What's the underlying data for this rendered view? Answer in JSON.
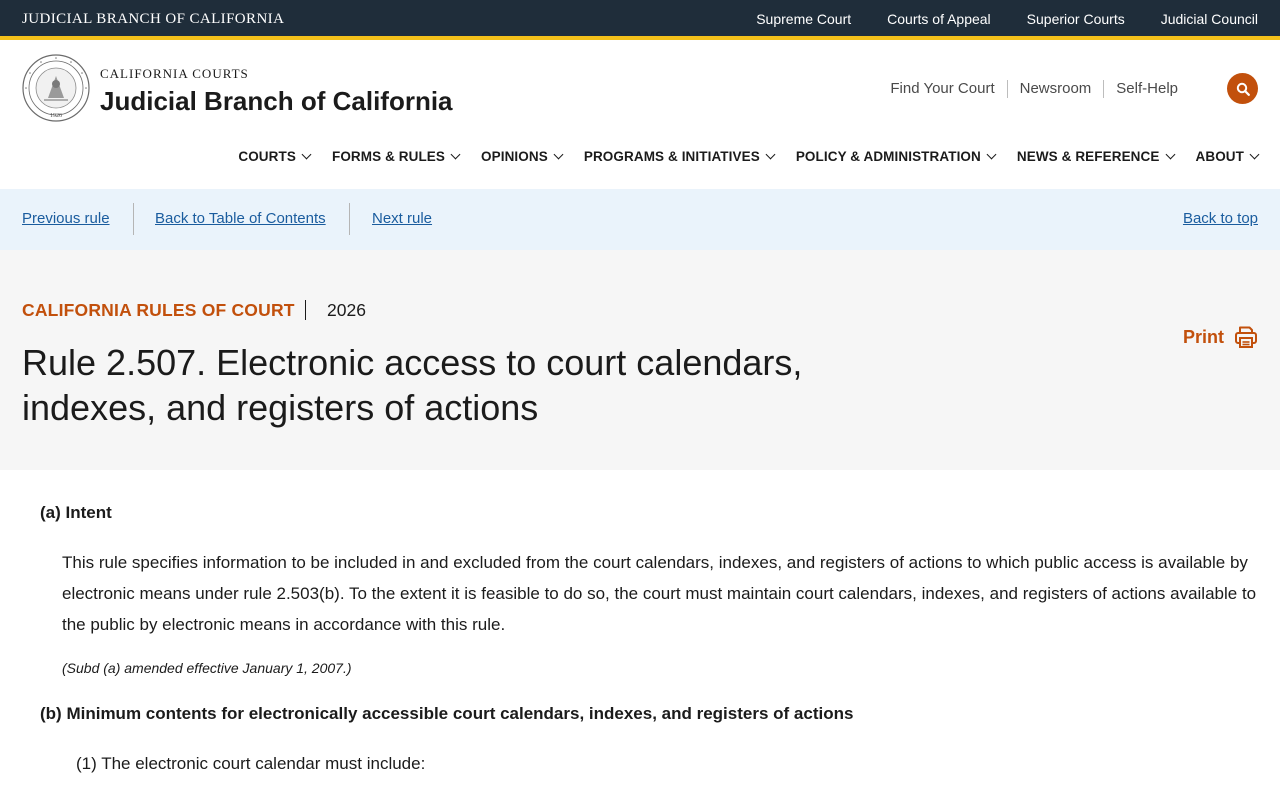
{
  "topbar": {
    "brand": "JUDICIAL BRANCH OF CALIFORNIA",
    "links": [
      "Supreme Court",
      "Courts of Appeal",
      "Superior Courts",
      "Judicial Council"
    ]
  },
  "header": {
    "eyebrow": "CALIFORNIA COURTS",
    "title": "Judicial Branch of California",
    "util_links": [
      "Find Your Court",
      "Newsroom",
      "Self-Help"
    ],
    "search_icon": "search-icon",
    "seal_year": "1926"
  },
  "nav": {
    "items": [
      "COURTS",
      "FORMS & RULES",
      "OPINIONS",
      "PROGRAMS & INITIATIVES",
      "POLICY & ADMINISTRATION",
      "NEWS & REFERENCE",
      "ABOUT"
    ]
  },
  "rulebar": {
    "previous": "Previous rule",
    "toc": "Back to Table of Contents",
    "next": "Next rule",
    "top": "Back to top"
  },
  "rule": {
    "eyebrow": "CALIFORNIA RULES OF COURT",
    "year": "2026",
    "title": "Rule 2.507. Electronic access to court calendars, indexes, and registers of actions",
    "print_label": "Print"
  },
  "body": {
    "a_label": "(a)",
    "a_heading": "Intent",
    "a_text": "This rule specifies information to be included in and excluded from the court calendars, indexes, and registers of actions to which public access is available by electronic means under rule 2.503(b). To the extent it is feasible to do so, the court must maintain court calendars, indexes, and registers of actions available to the public by electronic means in accordance with this rule.",
    "a_note": "(Subd (a) amended effective January 1, 2007.)",
    "b_label": "(b)",
    "b_heading": "Minimum contents for electronically accessible court calendars, indexes, and registers of actions",
    "b1_label": "(1)",
    "b1_text": "The electronic court calendar must include:"
  },
  "colors": {
    "topbar_bg": "#1f2d3a",
    "topbar_accent": "#f3c01a",
    "brand_orange": "#c2500c",
    "link_blue": "#1a5c9e",
    "rulebar_bg": "#eaf3fb",
    "titleband_bg": "#f6f6f6"
  }
}
